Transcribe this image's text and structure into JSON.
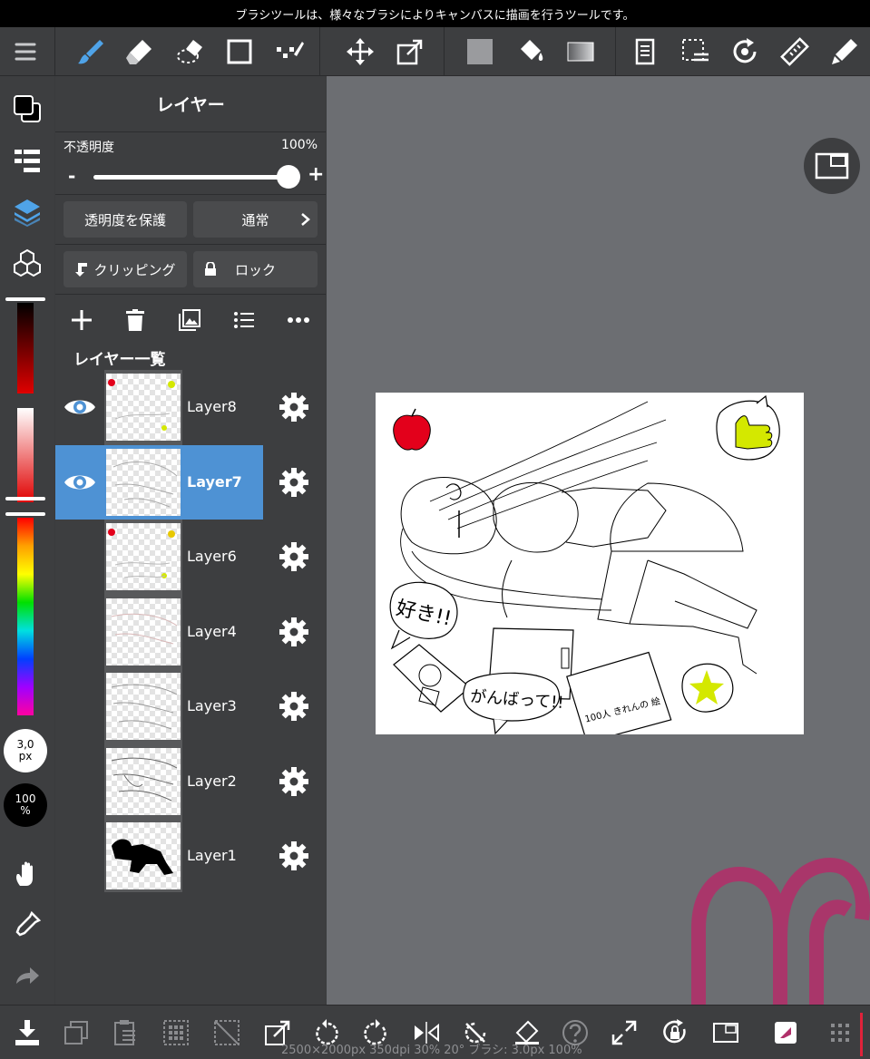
{
  "status_bar": {
    "text": "ブラシツールは、様々なブラシによりキャンバスに描画を行うツールです。"
  },
  "colors": {
    "accent": "#4e92d4",
    "panel": "#3d3e40",
    "canvas_bg": "#6c6e72",
    "watermark": "#b0306a"
  },
  "toolbar": {
    "icons": [
      "menu-icon",
      "brush-icon",
      "eraser-icon",
      "lasso-eraser-icon",
      "rect-select-icon",
      "select-pen-icon",
      "move-icon",
      "transform-icon",
      "fill-color-icon",
      "bucket-icon",
      "gradient-icon",
      "layer-property-icon",
      "selection-layer-icon",
      "rotate-snap-icon",
      "ruler-icon",
      "pen-assist-icon"
    ]
  },
  "left_rail": {
    "brush_size": {
      "value": "3,0",
      "unit": "px"
    },
    "brush_opacity": {
      "value": "100",
      "unit": "%"
    }
  },
  "layer_panel": {
    "title": "レイヤー",
    "opacity_label": "不透明度",
    "opacity_value": "100%",
    "opacity_level": 1.0,
    "slider_minus": "-",
    "slider_plus": "+",
    "protect_alpha": "透明度を保護",
    "blend_mode": "通常",
    "clipping": "クリッピング",
    "lock": "ロック",
    "list_title": "レイヤー一覧",
    "layers": [
      {
        "name": "Layer8",
        "visible": true,
        "selected": false
      },
      {
        "name": "Layer7",
        "visible": true,
        "selected": true
      },
      {
        "name": "Layer6",
        "visible": false,
        "selected": false
      },
      {
        "name": "Layer4",
        "visible": false,
        "selected": false
      },
      {
        "name": "Layer3",
        "visible": false,
        "selected": false
      },
      {
        "name": "Layer2",
        "visible": false,
        "selected": false
      },
      {
        "name": "Layer1",
        "visible": false,
        "selected": false
      }
    ]
  },
  "artwork": {
    "text_suki": "好き!!",
    "text_ganbatte": "がんばって!!",
    "text_note": "100人 きれんの 絵"
  },
  "bottom_status": "2500×2000px 350dpi 30% 20° ブラシ: 3.0px 100%"
}
